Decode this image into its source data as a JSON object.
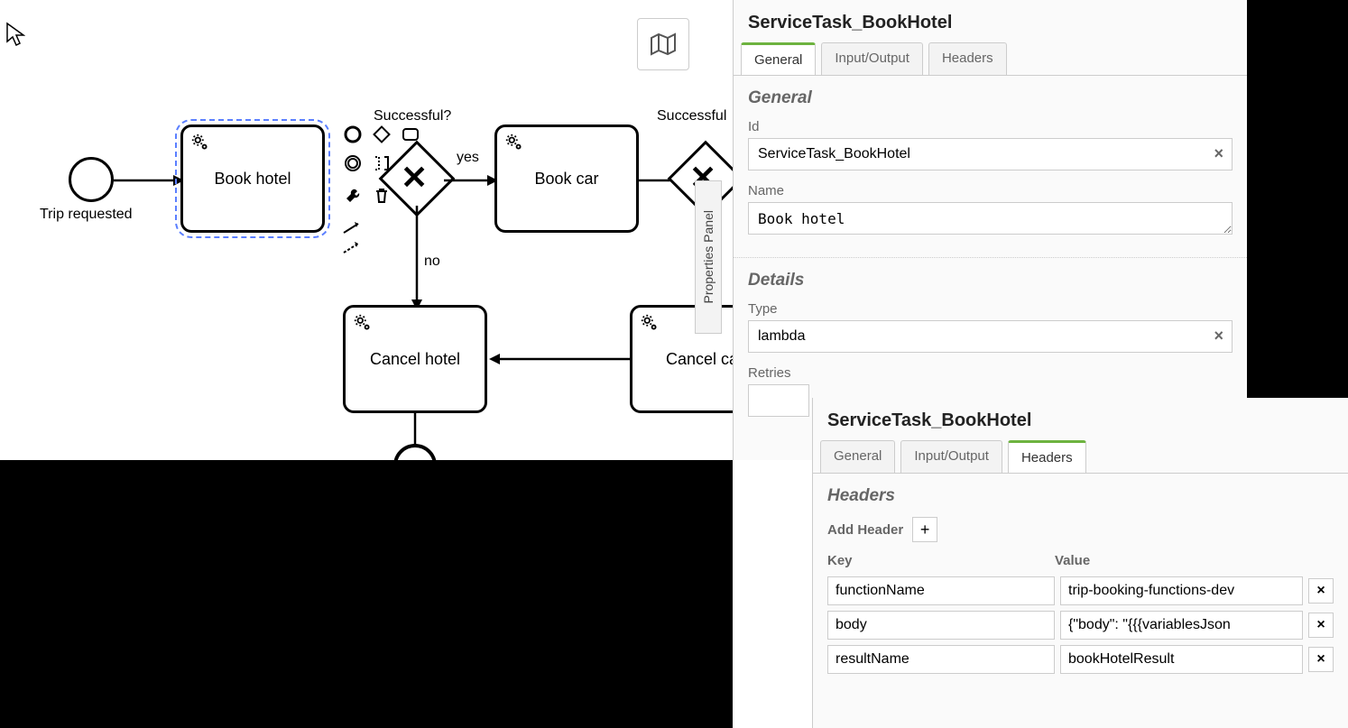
{
  "diagram": {
    "start_label": "Trip requested",
    "task_book_hotel": "Book hotel",
    "gateway1_label": "Successful?",
    "flow_yes": "yes",
    "flow_no": "no",
    "task_book_car": "Book car",
    "gateway2_label": "Successful",
    "task_cancel_hotel": "Cancel hotel",
    "task_cancel_car": "Cancel ca",
    "properties_panel_label": "Properties Panel"
  },
  "panel1": {
    "title": "ServiceTask_BookHotel",
    "tabs": {
      "general": "General",
      "io": "Input/Output",
      "headers": "Headers"
    },
    "section_general": "General",
    "id_label": "Id",
    "id_value": "ServiceTask_BookHotel",
    "name_label": "Name",
    "name_value": "Book hotel",
    "section_details": "Details",
    "type_label": "Type",
    "type_value": "lambda",
    "retries_label": "Retries",
    "retries_value": ""
  },
  "panel2": {
    "title": "ServiceTask_BookHotel",
    "tabs": {
      "general": "General",
      "io": "Input/Output",
      "headers": "Headers"
    },
    "section_headers": "Headers",
    "add_header_label": "Add Header",
    "col_key": "Key",
    "col_value": "Value",
    "rows": [
      {
        "key": "functionName",
        "value": "trip-booking-functions-dev"
      },
      {
        "key": "body",
        "value": "{\"body\": \"{{{variablesJson"
      },
      {
        "key": "resultName",
        "value": "bookHotelResult"
      }
    ]
  }
}
